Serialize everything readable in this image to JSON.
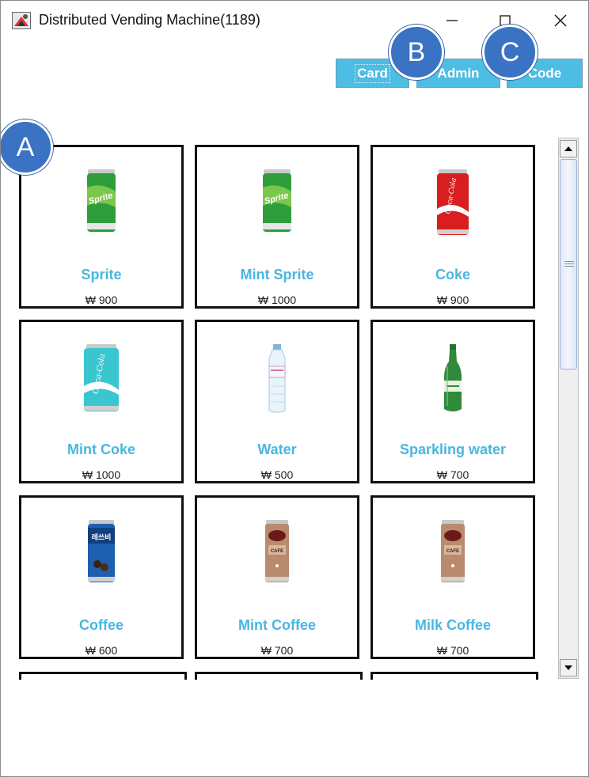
{
  "window": {
    "title": "Distributed Vending Machine(1189)"
  },
  "toolbar": {
    "card_label": "Card",
    "admin_label": "Admin",
    "code_label": "Code"
  },
  "callouts": {
    "a": "A",
    "b": "B",
    "c": "C"
  },
  "products": [
    {
      "name": "Sprite",
      "price": "₩ 900",
      "icon": "sprite-can-icon",
      "color": "#2e9e3c"
    },
    {
      "name": "Mint Sprite",
      "price": "₩ 1000",
      "icon": "sprite-can-icon",
      "color": "#2e9e3c"
    },
    {
      "name": "Coke",
      "price": "₩ 900",
      "icon": "coke-can-icon",
      "color": "#d81e1e"
    },
    {
      "name": "Mint Coke",
      "price": "₩ 1000",
      "icon": "mint-coke-can-icon",
      "color": "#39c6cf"
    },
    {
      "name": "Water",
      "price": "₩ 500",
      "icon": "water-bottle-icon",
      "color": "#cfe6f3"
    },
    {
      "name": "Sparkling water",
      "price": "₩ 700",
      "icon": "sparkling-water-bottle-icon",
      "color": "#2f8a3a"
    },
    {
      "name": "Coffee",
      "price": "₩ 600",
      "icon": "coffee-can-icon",
      "color": "#1f5fb0"
    },
    {
      "name": "Mint Coffee",
      "price": "₩ 700",
      "icon": "cafe-latte-can-icon",
      "color": "#b98a6e"
    },
    {
      "name": "Milk Coffee",
      "price": "₩ 700",
      "icon": "cafe-latte-can-icon",
      "color": "#b98a6e"
    }
  ],
  "colors": {
    "accent": "#4dbde4",
    "product_name": "#4ab6e0",
    "callout": "#3a72c4"
  }
}
